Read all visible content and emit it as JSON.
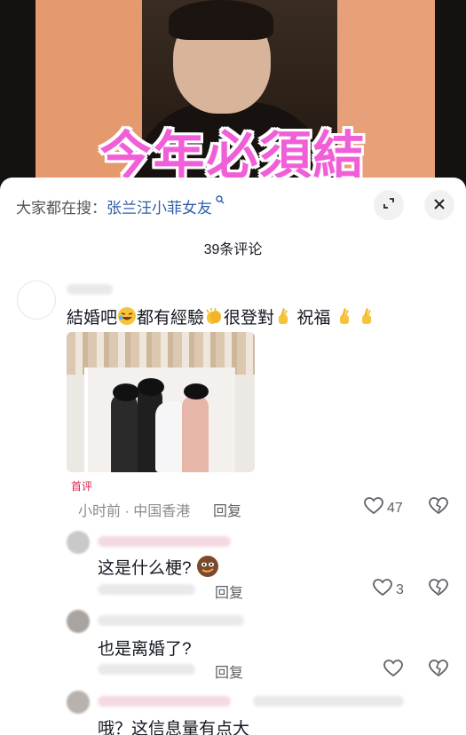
{
  "video": {
    "caption": "今年必須結"
  },
  "sheet": {
    "search_prefix": "大家都在搜：",
    "search_term": "张兰汪小菲女友",
    "search_icon": "search-icon",
    "expand_icon": "expand-icon",
    "close_icon": "close-icon",
    "comment_count": "39条评论"
  },
  "comments": [
    {
      "text_a": "結婚吧",
      "text_b": "都有經驗",
      "text_c": "很登對",
      "text_d": "祝福",
      "emojis": [
        "laughing-emoji",
        "clapping-emoji",
        "fingers-crossed-emoji"
      ],
      "badge": "首评",
      "time_location": "小时前 · 中国香港",
      "reply_label": "回复",
      "likes": "47"
    },
    {
      "text": "这是什么梗?",
      "emoji": "smug-face-emoji",
      "reply_label": "回复",
      "likes": "3"
    },
    {
      "text": "也是离婚了?",
      "reply_label": "回复",
      "likes": ""
    },
    {
      "text": "哦？这信息量有点大"
    }
  ]
}
